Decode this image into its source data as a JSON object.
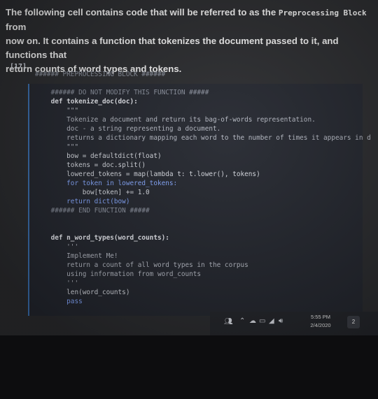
{
  "markdown": {
    "line1_pre": "The following cell contains code that will be referred to as the",
    "line1_code": "Preprocessing Block",
    "line1_post": "from",
    "line2": "now on. It contains a function that tokenizes the document passed to it, and functions that",
    "line3": "return counts of word types and tokens."
  },
  "cell": {
    "prompt": "[17]",
    "lines": [
      {
        "t": "###### PREPROCESSING BLOCK ######",
        "cls": "cmt"
      },
      {
        "t": "",
        "cls": ""
      },
      {
        "t": "    ###### DO NOT MODIFY THIS FUNCTION #####",
        "cls": "cmt"
      },
      {
        "t": "    def tokenize_doc(doc):",
        "cls": "fn"
      },
      {
        "t": "        \"\"\"",
        "cls": "str"
      },
      {
        "t": "        Tokenize a document and return its bag-of-words representation.",
        "cls": "str"
      },
      {
        "t": "        doc - a string representing a document.",
        "cls": "str"
      },
      {
        "t": "        returns a dictionary mapping each word to the number of times it appears in d",
        "cls": "str"
      },
      {
        "t": "        \"\"\"",
        "cls": "str"
      },
      {
        "t": "        bow = defaultdict(float)",
        "cls": ""
      },
      {
        "t": "        tokens = doc.split()",
        "cls": ""
      },
      {
        "t": "        lowered_tokens = map(lambda t: t.lower(), tokens)",
        "cls": ""
      },
      {
        "t": "        for token in lowered_tokens:",
        "cls": "kw"
      },
      {
        "t": "            bow[token] += 1.0",
        "cls": ""
      },
      {
        "t": "        return dict(bow)",
        "cls": "kw"
      },
      {
        "t": "    ###### END FUNCTION #####",
        "cls": "cmt"
      },
      {
        "t": "",
        "cls": ""
      },
      {
        "t": "",
        "cls": ""
      },
      {
        "t": "    def n_word_types(word_counts):",
        "cls": "fn"
      },
      {
        "t": "        '''",
        "cls": "str"
      },
      {
        "t": "        Implement Me!",
        "cls": "str"
      },
      {
        "t": "        return a count of all word types in the corpus",
        "cls": "str"
      },
      {
        "t": "        using information from word_counts",
        "cls": "str"
      },
      {
        "t": "        '''",
        "cls": "str"
      },
      {
        "t": "        len(word_counts)",
        "cls": ""
      },
      {
        "t": "        pass",
        "cls": "kw"
      }
    ]
  },
  "taskbar": {
    "tray_icons": [
      "people-icon",
      "chevron-up-icon",
      "cloud-icon",
      "battery-icon",
      "network-icon",
      "volume-icon"
    ],
    "time": "5:55 PM",
    "date": "2/4/2020",
    "notification_count": "2"
  }
}
